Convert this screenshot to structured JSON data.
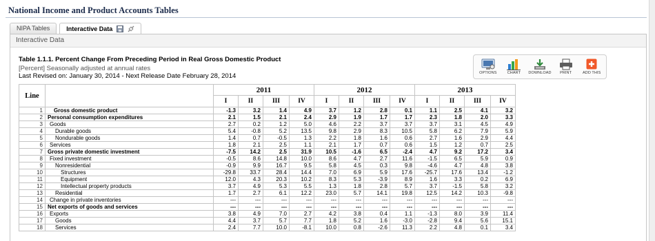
{
  "page": {
    "title": "National Income and Product Accounts Tables"
  },
  "tabs": [
    {
      "label": "NIPA Tables"
    },
    {
      "label": "Interactive Data"
    }
  ],
  "panel": {
    "header": "Interactive Data",
    "table_title": "Table 1.1.1. Percent Change From Preceding Period in Real Gross Domestic Product",
    "subtitle": "[Percent] Seasonally adjusted at annual rates",
    "revised": "Last Revised on: January 30, 2014 - Next Release Date February 28, 2014"
  },
  "toolbar": {
    "options": "OPTIONS",
    "chart": "CHART",
    "download": "DOWNLOAD",
    "print": "PRINT",
    "add_this": "ADD THIS"
  },
  "table": {
    "line_header": "Line",
    "years": [
      "2011",
      "2012",
      "2013"
    ],
    "quarters": [
      "I",
      "II",
      "III",
      "IV",
      "I",
      "II",
      "III",
      "IV",
      "I",
      "II",
      "III",
      "IV"
    ],
    "rows": [
      {
        "line": "1",
        "label": "Gross domestic product",
        "indent": "ind0b",
        "bold": true,
        "values": [
          "-1.3",
          "3.2",
          "1.4",
          "4.9",
          "3.7",
          "1.2",
          "2.8",
          "0.1",
          "1.1",
          "2.5",
          "4.1",
          "3.2"
        ]
      },
      {
        "line": "2",
        "label": "Personal consumption expenditures",
        "indent": "",
        "bold": true,
        "values": [
          "2.1",
          "1.5",
          "2.1",
          "2.4",
          "2.9",
          "1.9",
          "1.7",
          "1.7",
          "2.3",
          "1.8",
          "2.0",
          "3.3"
        ]
      },
      {
        "line": "3",
        "label": "Goods",
        "indent": "ind1",
        "bold": false,
        "values": [
          "2.7",
          "0.2",
          "1.2",
          "5.0",
          "4.6",
          "2.2",
          "3.7",
          "3.7",
          "3.7",
          "3.1",
          "4.5",
          "4.9"
        ]
      },
      {
        "line": "4",
        "label": "Durable goods",
        "indent": "ind2",
        "bold": false,
        "values": [
          "5.4",
          "-0.8",
          "5.2",
          "13.5",
          "9.8",
          "2.9",
          "8.3",
          "10.5",
          "5.8",
          "6.2",
          "7.9",
          "5.9"
        ]
      },
      {
        "line": "5",
        "label": "Nondurable goods",
        "indent": "ind2",
        "bold": false,
        "values": [
          "1.4",
          "0.7",
          "-0.5",
          "1.3",
          "2.2",
          "1.8",
          "1.6",
          "0.6",
          "2.7",
          "1.6",
          "2.9",
          "4.4"
        ]
      },
      {
        "line": "6",
        "label": "Services",
        "indent": "ind1",
        "bold": false,
        "values": [
          "1.8",
          "2.1",
          "2.5",
          "1.1",
          "2.1",
          "1.7",
          "0.7",
          "0.6",
          "1.5",
          "1.2",
          "0.7",
          "2.5"
        ]
      },
      {
        "line": "7",
        "label": "Gross private domestic investment",
        "indent": "",
        "bold": true,
        "values": [
          "-7.5",
          "14.2",
          "2.5",
          "31.9",
          "10.5",
          "-1.6",
          "6.5",
          "-2.4",
          "4.7",
          "9.2",
          "17.2",
          "3.4"
        ]
      },
      {
        "line": "8",
        "label": "Fixed investment",
        "indent": "ind1",
        "bold": false,
        "values": [
          "-0.5",
          "8.6",
          "14.8",
          "10.0",
          "8.6",
          "4.7",
          "2.7",
          "11.6",
          "-1.5",
          "6.5",
          "5.9",
          "0.9"
        ]
      },
      {
        "line": "9",
        "label": "Nonresidential",
        "indent": "ind2",
        "bold": false,
        "values": [
          "-0.9",
          "9.9",
          "16.7",
          "9.5",
          "5.8",
          "4.5",
          "0.3",
          "9.8",
          "-4.6",
          "4.7",
          "4.8",
          "3.8"
        ]
      },
      {
        "line": "10",
        "label": "Structures",
        "indent": "ind3",
        "bold": false,
        "values": [
          "-29.8",
          "33.7",
          "28.4",
          "14.4",
          "7.0",
          "6.9",
          "5.9",
          "17.6",
          "-25.7",
          "17.6",
          "13.4",
          "-1.2"
        ]
      },
      {
        "line": "11",
        "label": "Equipment",
        "indent": "ind3",
        "bold": false,
        "values": [
          "12.0",
          "4.3",
          "20.3",
          "10.2",
          "8.3",
          "5.3",
          "-3.9",
          "8.9",
          "1.6",
          "3.3",
          "0.2",
          "6.9"
        ]
      },
      {
        "line": "12",
        "label": "Intellectual property products",
        "indent": "ind3",
        "bold": false,
        "values": [
          "3.7",
          "4.9",
          "5.3",
          "5.5",
          "1.3",
          "1.8",
          "2.8",
          "5.7",
          "3.7",
          "-1.5",
          "5.8",
          "3.2"
        ]
      },
      {
        "line": "13",
        "label": "Residential",
        "indent": "ind2",
        "bold": false,
        "values": [
          "1.7",
          "2.7",
          "6.1",
          "12.2",
          "23.0",
          "5.7",
          "14.1",
          "19.8",
          "12.5",
          "14.2",
          "10.3",
          "-9.8"
        ]
      },
      {
        "line": "14",
        "label": "Change in private inventories",
        "indent": "ind1",
        "bold": false,
        "values": [
          "---",
          "---",
          "---",
          "---",
          "---",
          "---",
          "---",
          "---",
          "---",
          "---",
          "---",
          "---"
        ]
      },
      {
        "line": "15",
        "label": "Net exports of goods and services",
        "indent": "",
        "bold": true,
        "values": [
          "---",
          "---",
          "---",
          "---",
          "---",
          "---",
          "---",
          "---",
          "---",
          "---",
          "---",
          "---"
        ]
      },
      {
        "line": "16",
        "label": "Exports",
        "indent": "ind1",
        "bold": false,
        "values": [
          "3.8",
          "4.9",
          "7.0",
          "2.7",
          "4.2",
          "3.8",
          "0.4",
          "1.1",
          "-1.3",
          "8.0",
          "3.9",
          "11.4"
        ]
      },
      {
        "line": "17",
        "label": "Goods",
        "indent": "ind2",
        "bold": false,
        "values": [
          "4.4",
          "3.7",
          "5.7",
          "7.7",
          "1.8",
          "5.2",
          "1.6",
          "-3.0",
          "-2.8",
          "9.4",
          "5.6",
          "15.1"
        ]
      },
      {
        "line": "18",
        "label": "Services",
        "indent": "ind2",
        "bold": false,
        "values": [
          "2.4",
          "7.7",
          "10.0",
          "-8.1",
          "10.0",
          "0.8",
          "-2.6",
          "11.3",
          "2.2",
          "4.8",
          "0.1",
          "3.4"
        ]
      }
    ]
  }
}
